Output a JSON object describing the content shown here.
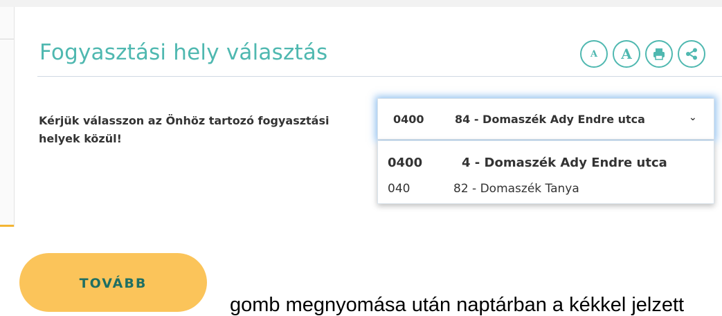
{
  "page": {
    "title": "Fogyasztási hely választás",
    "instruction": "Kérjük válasszon az Önhöz tartozó fogyasztási helyek közül!",
    "tools": [
      {
        "label": "A",
        "icon": "font-decrease-icon"
      },
      {
        "label": "A",
        "icon": "font-increase-icon"
      },
      {
        "label": "",
        "icon": "print-icon"
      },
      {
        "label": "",
        "icon": "share-icon"
      }
    ]
  },
  "select": {
    "selected_code": "0400",
    "selected_address": "84 - Domaszék Ady Endre utca",
    "options": [
      {
        "code": "0400",
        "address": "4 - Domaszék Ady Endre utca"
      },
      {
        "code": "040",
        "address": "82 - Domaszék Tanya"
      }
    ]
  },
  "actions": {
    "next_label": "TOVÁBB"
  },
  "footer_text": "gomb megnyomása után naptárban a kékkel jelzett",
  "colors": {
    "accent": "#4fb8b0",
    "button": "#fbc45a",
    "button_text": "#1f6f63",
    "focus_glow": "#3f92e4"
  }
}
